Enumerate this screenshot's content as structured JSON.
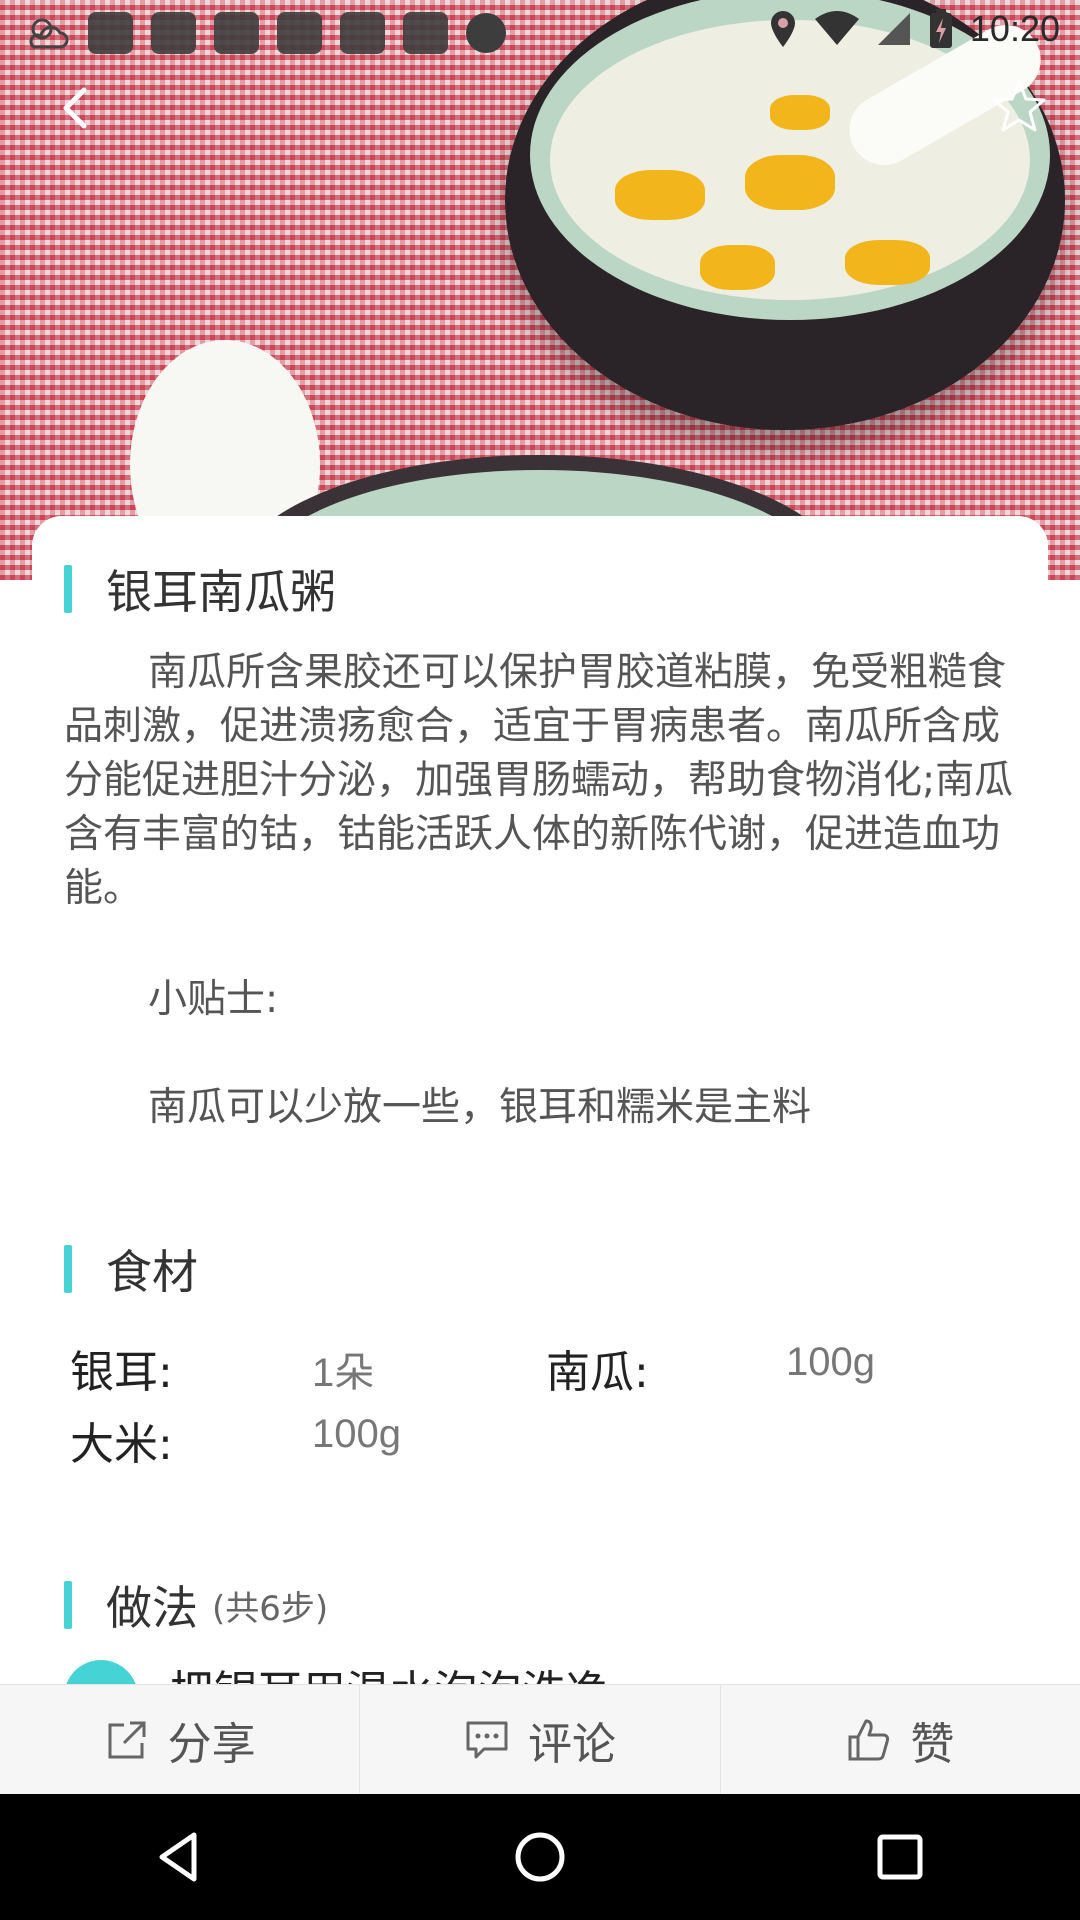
{
  "status_bar": {
    "time": "10:20",
    "icons": [
      "weather-cloud-icon",
      "notification-icon",
      "notification-icon",
      "notification-icon",
      "notification-icon",
      "notification-icon",
      "notification-icon",
      "notification-dot-icon",
      "location-icon",
      "wifi-icon",
      "signal-icon",
      "battery-charging-icon"
    ]
  },
  "header": {
    "back_icon": "chevron-left-icon",
    "favorite_icon": "star-outline-icon"
  },
  "recipe": {
    "title": "银耳南瓜粥",
    "description": "南瓜所含果胶还可以保护胃胶道粘膜，免受粗糙食品刺激，促进溃疡愈合，适宜于胃病患者。南瓜所含成分能促进胆汁分泌，加强胃肠蠕动，帮助食物消化;南瓜含有丰富的钴，钴能活跃人体的新陈代谢，促进造血功能。",
    "tips_label": "小贴士:",
    "tips_text": "南瓜可以少放一些，银耳和糯米是主料"
  },
  "ingredients": {
    "title": "食材",
    "items": [
      {
        "name": "银耳:",
        "amount": "1朵"
      },
      {
        "name": "南瓜:",
        "amount": "100g"
      },
      {
        "name": "大米:",
        "amount": "100g"
      }
    ]
  },
  "method": {
    "title": "做法",
    "count": "(共6步)",
    "first_step_text": "把银耳用温水泡泡洗净"
  },
  "actions": [
    {
      "label": "分享",
      "icon": "share-icon"
    },
    {
      "label": "评论",
      "icon": "comment-icon"
    },
    {
      "label": "赞",
      "icon": "thumbs-up-icon"
    }
  ],
  "nav": [
    "back-triangle-icon",
    "home-circle-icon",
    "recents-square-icon"
  ]
}
